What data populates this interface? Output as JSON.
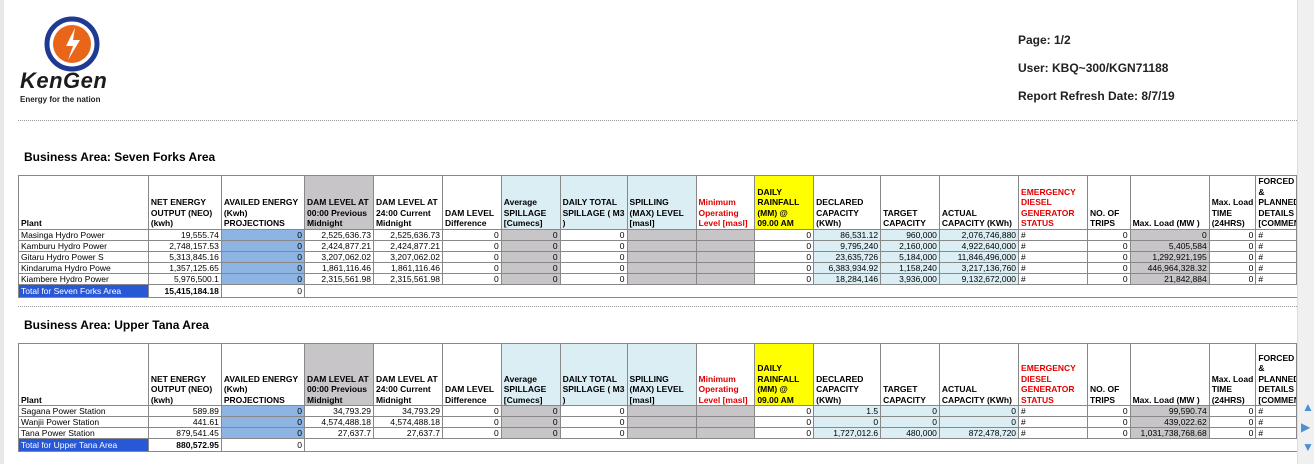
{
  "brand": {
    "name": "KenGen",
    "tagline": "Energy for the nation"
  },
  "meta": {
    "page": "Page: 1/2",
    "user": "User: KBQ~300/KGN71188",
    "refresh": "Report Refresh Date: 8/7/19"
  },
  "sections": [
    {
      "title": "Business Area: Seven Forks Area",
      "headers": [
        "Plant",
        "NET ENERGY OUTPUT (NEO) (kwh)",
        "AVAILED ENERGY (Kwh) PROJECTIONS",
        "DAM LEVEL AT 00:00 Previous Midnight",
        "DAM LEVEL AT 24:00 Current Midnight",
        "DAM LEVEL Difference",
        "Average SPILLAGE [Cumecs]",
        "DAILY TOTAL SPILLAGE ( M3 )",
        "SPILLING (MAX) LEVEL [masl]",
        "Minimum Operating Level [masl]",
        "DAILY RAINFALL (MM) @ 09.00 AM",
        "DECLARED CAPACITY (KWh)",
        "TARGET CAPACITY",
        "ACTUAL CAPACITY (KWh)",
        "EMERGENCY DIESEL GENERATOR STATUS",
        "NO. OF TRIPS",
        "Max. Load (MW )",
        "Max. Load TIME (24HRS)",
        "FORCED & PLANNED DETAILS [COMMENTS]"
      ],
      "rows": [
        [
          "Masinga Hydro Power",
          "19,555.74",
          "0",
          "2,525,636.73",
          "2,525,636.73",
          "0",
          "0",
          "0",
          "",
          "",
          "0",
          "86,531.12",
          "960,000",
          "2,076,746,880",
          "#",
          "0",
          "0",
          "0",
          "#"
        ],
        [
          "Kamburu Hydro Power",
          "2,748,157.53",
          "0",
          "2,424,877.21",
          "2,424,877.21",
          "0",
          "0",
          "0",
          "",
          "",
          "0",
          "9,795,240",
          "2,160,000",
          "4,922,640,000",
          "#",
          "0",
          "5,405,584",
          "0",
          "#"
        ],
        [
          "Gitaru Hydro Power S",
          "5,313,845.16",
          "0",
          "3,207,062.02",
          "3,207,062.02",
          "0",
          "0",
          "0",
          "",
          "",
          "0",
          "23,635,726",
          "5,184,000",
          "11,846,496,000",
          "#",
          "0",
          "1,292,921,195",
          "0",
          "#"
        ],
        [
          "Kindaruma Hydro Powe",
          "1,357,125.65",
          "0",
          "1,861,116.46",
          "1,861,116.46",
          "0",
          "0",
          "0",
          "",
          "",
          "0",
          "6,383,934.92",
          "1,158,240",
          "3,217,136,760",
          "#",
          "0",
          "446,964,328.32",
          "0",
          "#"
        ],
        [
          "Kiambere Hydro Power",
          "5,976,500.1",
          "0",
          "2,315,561.98",
          "2,315,561.98",
          "0",
          "0",
          "0",
          "",
          "",
          "0",
          "18,284,146",
          "3,936,000",
          "9,132,672,000",
          "#",
          "0",
          "21,842,884",
          "0",
          "#"
        ]
      ],
      "total": {
        "label": "Total for Seven Forks Area",
        "neo": "15,415,184.18",
        "availed": "0"
      }
    },
    {
      "title": "Business Area: Upper Tana Area",
      "headers": [
        "Plant",
        "NET ENERGY OUTPUT (NEO) (kwh)",
        "AVAILED ENERGY (Kwh) PROJECTIONS",
        "DAM LEVEL AT 00:00 Previous Midnight",
        "DAM LEVEL AT 24:00 Current Midnight",
        "DAM LEVEL Difference",
        "Average SPILLAGE [Cumecs]",
        "DAILY TOTAL SPILLAGE ( M3 )",
        "SPILLING (MAX) LEVEL [masl]",
        "Minimum Operating Level [masl]",
        "DAILY RAINFALL (MM) @ 09.00 AM",
        "DECLARED CAPACITY (KWh)",
        "TARGET CAPACITY",
        "ACTUAL CAPACITY (KWh)",
        "EMERGENCY DIESEL GENERATOR STATUS",
        "NO. OF TRIPS",
        "Max. Load (MW )",
        "Max. Load TIME (24HRS)",
        "FORCED & PLANNED DETAILS [COMMENTS]"
      ],
      "rows": [
        [
          "Sagana Power Station",
          "589.89",
          "0",
          "34,793.29",
          "34,793.29",
          "0",
          "0",
          "0",
          "",
          "",
          "0",
          "1.5",
          "0",
          "0",
          "#",
          "0",
          "99,590.74",
          "0",
          "#"
        ],
        [
          "Wanjii Power Station",
          "441.61",
          "0",
          "4,574,488.18",
          "4,574,488.18",
          "0",
          "0",
          "0",
          "",
          "",
          "0",
          "0",
          "0",
          "0",
          "#",
          "0",
          "439,022.62",
          "0",
          "#"
        ],
        [
          "Tana Power Station",
          "879,541.45",
          "0",
          "27,637.7",
          "27,637.7",
          "0",
          "0",
          "0",
          "",
          "",
          "0",
          "1,727,012.6",
          "480,000",
          "872,478,720",
          "#",
          "0",
          "1,031,738,768.68",
          "0",
          "#"
        ]
      ],
      "total": {
        "label": "Total for Upper Tana Area",
        "neo": "880,572.95",
        "availed": "0"
      }
    }
  ]
}
